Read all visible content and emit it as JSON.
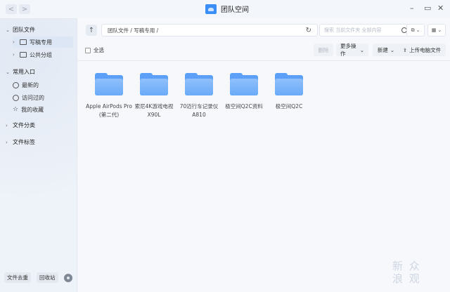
{
  "window": {
    "title": "团队空间",
    "minimize": "–",
    "maximize": "▭",
    "close": "✕"
  },
  "nav": {
    "back": "<",
    "forward": ">"
  },
  "sidebar": {
    "team_files": {
      "header": "团队文件",
      "items": [
        {
          "label": "写稿专用"
        },
        {
          "label": "公共分组"
        }
      ]
    },
    "common": {
      "header": "常用入口",
      "items": [
        {
          "label": "最新的"
        },
        {
          "label": "访问过的"
        },
        {
          "label": "我的收藏"
        }
      ]
    },
    "file_category": {
      "header": "文件分类"
    },
    "file_tags": {
      "header": "文件标签"
    },
    "bottom": {
      "dedup": "文件去重",
      "recycle": "回收站"
    }
  },
  "toolbar": {
    "up": "↑",
    "path": "团队文件 / 写稿专用 /",
    "refresh": "↻",
    "search_placeholder": "搜索 当前文件夹 全部内容",
    "select_all": "全选",
    "delete": "删除",
    "more_ops": "更多操作",
    "new": "新建",
    "upload": "上传电脑文件"
  },
  "files": [
    {
      "name": "Apple AirPods Pro (第二代)"
    },
    {
      "name": "索尼4K游戏电视 X90L"
    },
    {
      "name": "70迈行车记录仪 A810"
    },
    {
      "name": "极空间Q2C资料"
    },
    {
      "name": "极空间Q2C"
    }
  ],
  "watermark": "新 众\n浪 观"
}
